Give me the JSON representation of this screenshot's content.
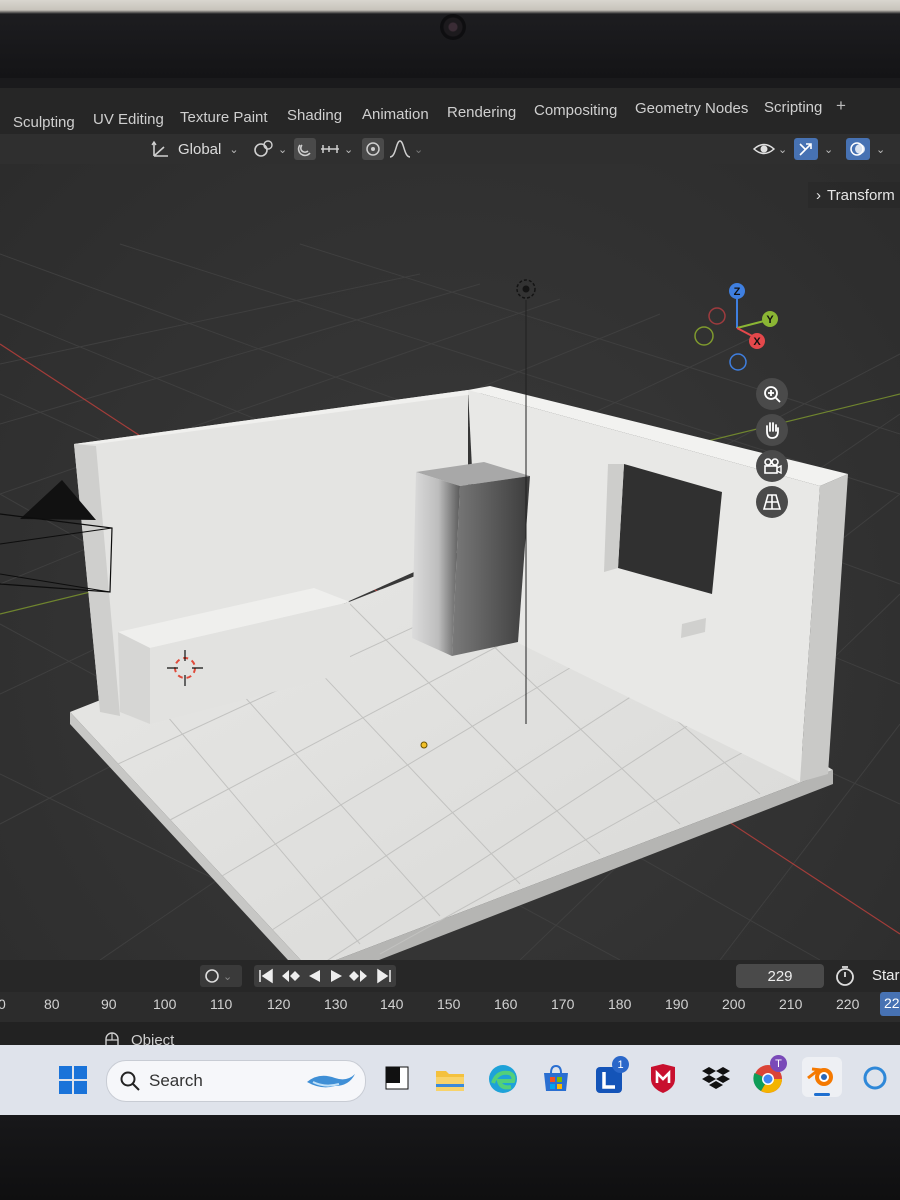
{
  "workspace_tabs": [
    "Sculpting",
    "UV Editing",
    "Texture Paint",
    "Shading",
    "Animation",
    "Rendering",
    "Compositing",
    "Geometry Nodes",
    "Scripting"
  ],
  "workspace_add": "+",
  "header": {
    "transform_orientation": "Global"
  },
  "sidebar": {
    "transform_tab": "Transform"
  },
  "gizmo": {
    "z": "Z",
    "y": "Y",
    "x": "X"
  },
  "playback": {
    "current_frame": "229",
    "start_label": "Star"
  },
  "ruler": [
    "0",
    "80",
    "90",
    "100",
    "110",
    "120",
    "130",
    "140",
    "150",
    "160",
    "170",
    "180",
    "190",
    "200",
    "210",
    "220",
    "22"
  ],
  "status": {
    "mode": "Object"
  },
  "taskbar": {
    "search_placeholder": "Search",
    "badge_l": "1",
    "badge_chrome": "T"
  },
  "colors": {
    "accent": "#4772b3",
    "x_axis": "#e4484b",
    "y_axis": "#8bb634",
    "z_axis": "#3f7fe0",
    "grid_red": "#c0403c"
  }
}
